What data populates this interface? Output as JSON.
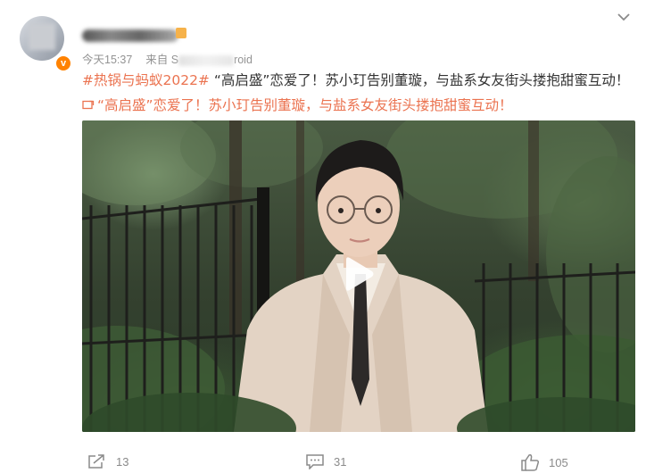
{
  "post": {
    "meta": {
      "time": "今天15:37",
      "source_prefix": "来自 S",
      "source_suffix": "roid"
    },
    "text": {
      "hashtag": "#热锅与蚂蚁2022#",
      "main": " “高启盛”恋爱了！苏小玎告别董璇，与盐系女友街头搂抱甜蜜互动！"
    },
    "link": {
      "label": "“高启盛”恋爱了！苏小玎告别董璇，与盐系女友街头搂抱甜蜜互动！"
    },
    "actions": {
      "repost_count": "13",
      "comment_count": "31",
      "like_count": "105"
    }
  },
  "colors": {
    "hashtag": "#eb7350",
    "meta": "#939393",
    "verified_badge": "#ff8200"
  },
  "icons": [
    "more-chevron-icon",
    "link-icon",
    "play-icon",
    "repost-icon",
    "comment-icon",
    "like-icon",
    "verified-badge-icon"
  ]
}
